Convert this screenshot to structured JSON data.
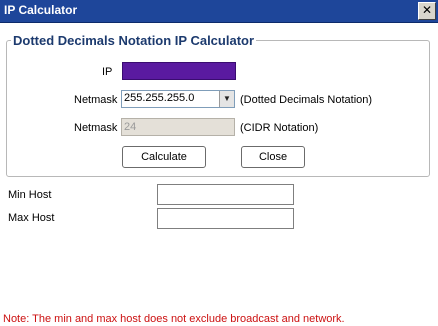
{
  "window": {
    "title": "IP Calculator",
    "close_glyph": "✕"
  },
  "group": {
    "legend": "Dotted Decimals Notation IP Calculator"
  },
  "form": {
    "ip_label": "IP",
    "ip_value": "",
    "netmask_label": "Netmask",
    "netmask_selected": "255.255.255.0",
    "netmask_hint": "(Dotted Decimals Notation)",
    "netmask_cidr_label": "Netmask",
    "cidr_value": "24",
    "cidr_hint": "(CIDR Notation)",
    "calculate_label": "Calculate",
    "close_label": "Close"
  },
  "results": {
    "min_host_label": "Min Host",
    "min_host_value": "",
    "max_host_label": "Max Host",
    "max_host_value": ""
  },
  "note": "Note: The min and max host does not exclude broadcast and network.",
  "colors": {
    "titlebar": "#1e469a",
    "legend": "#1c3a6e",
    "ip_field_fill": "#5a1aa0",
    "note_text": "#cc1111"
  }
}
